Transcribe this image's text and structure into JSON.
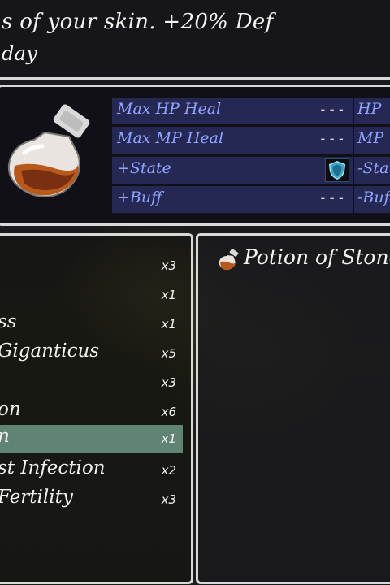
{
  "help": {
    "line1": "s of your skin. +20% Def",
    "line2": "day"
  },
  "stats": {
    "rows": [
      {
        "label": "Max HP Heal",
        "value": "---",
        "right_label": "HP"
      },
      {
        "label": "Max MP Heal",
        "value": "---",
        "right_label": "MP"
      },
      {
        "label": "+State",
        "value": "",
        "right_label": "-Sta"
      },
      {
        "label": "+Buff",
        "value": "---",
        "right_label": "-Buf"
      }
    ],
    "item_icon": "potion-bottle-icon",
    "state_icon": "shield-icon"
  },
  "items": [
    {
      "name": "",
      "qty": "x3"
    },
    {
      "name": "",
      "qty": "x1"
    },
    {
      "name": "ss",
      "qty": "x1"
    },
    {
      "name": "Giganticus",
      "qty": "x5"
    },
    {
      "name": "",
      "qty": "x3"
    },
    {
      "name": "on",
      "qty": "x6"
    },
    {
      "name": "n",
      "qty": "x1"
    },
    {
      "name": "st Infection",
      "qty": "x2"
    },
    {
      "name": "Fertility",
      "qty": "x3"
    }
  ],
  "selected_index": 6,
  "detail": {
    "title": "Potion of Stone",
    "icon": "potion-icon"
  },
  "colors": {
    "stat_row_bg": "#242852",
    "stat_label": "#8fa3ff",
    "selection": "#78aa96",
    "window_border": "#d8d8d8"
  }
}
